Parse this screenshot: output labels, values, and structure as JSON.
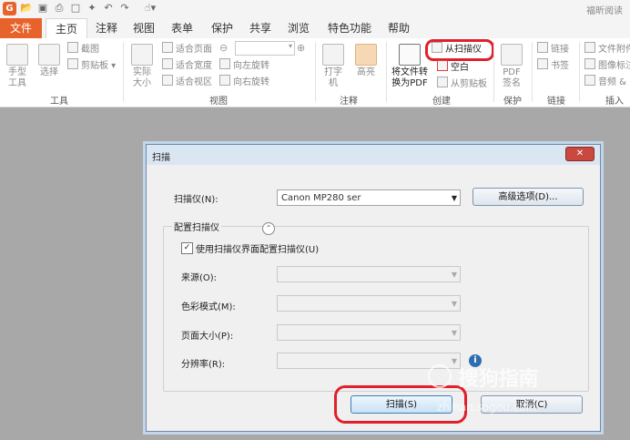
{
  "app": {
    "logo_letter": "G",
    "title": "福昕阅读",
    "quick_access": [
      "open-icon",
      "save-icon",
      "print-icon",
      "page-icon",
      "new-icon",
      "undo-icon",
      "redo-icon",
      "hand-icon"
    ]
  },
  "tabs": [
    {
      "label": "文件",
      "active": false
    },
    {
      "label": "主页",
      "active": true
    },
    {
      "label": "注释"
    },
    {
      "label": "视图"
    },
    {
      "label": "表单"
    },
    {
      "label": "保护"
    },
    {
      "label": "共享"
    },
    {
      "label": "浏览"
    },
    {
      "label": "特色功能"
    },
    {
      "label": "帮助"
    }
  ],
  "ribbon": {
    "tools": {
      "hand": "手型工具",
      "select": "选择",
      "snapshot": "截图",
      "clipboard": "剪贴板",
      "label": "工具"
    },
    "view": {
      "actual_size": "实际大小",
      "fit_page": "适合页面",
      "fit_width": "适合宽度",
      "fit_view": "适合视区",
      "rotate_left": "向左旋转",
      "rotate_right": "向右旋转",
      "label": "视图"
    },
    "comment": {
      "typewriter": "打字机",
      "highlight": "高亮",
      "label": "注释"
    },
    "create": {
      "convert": "将文件转换为PDF",
      "from_scanner": "从扫描仪",
      "blank": "空白",
      "from_clipboard": "从剪贴板",
      "label": "创建"
    },
    "protect": {
      "pdf_sign": "PDF签名",
      "label": "保护"
    },
    "links": {
      "link": "链接",
      "bookmark": "书签",
      "label": "链接"
    },
    "insert": {
      "attachment": "文件附件",
      "image": "图像标注",
      "audio": "音频 &",
      "label": "插入"
    }
  },
  "dialog": {
    "title": "扫描",
    "scanner_label": "扫描仪(N):",
    "scanner_value": "Canon MP280 ser",
    "advanced_button": "高级选项(D)...",
    "config_group": "配置扫描仪",
    "use_ui_label": "使用扫描仪界面配置扫描仪(U)",
    "use_ui_checked": true,
    "source_label": "来源(O):",
    "color_label": "色彩模式(M):",
    "page_size_label": "页面大小(P):",
    "resolution_label": "分辨率(R):",
    "scan_button": "扫描(S)",
    "cancel_button": "取消(C)"
  },
  "watermark": {
    "text": "搜狗指南",
    "url": "zhinan.sogou.com"
  },
  "colors": {
    "accent": "#e8632b",
    "highlight_red": "#e0202a",
    "dialog_border": "#6e8aa8"
  }
}
